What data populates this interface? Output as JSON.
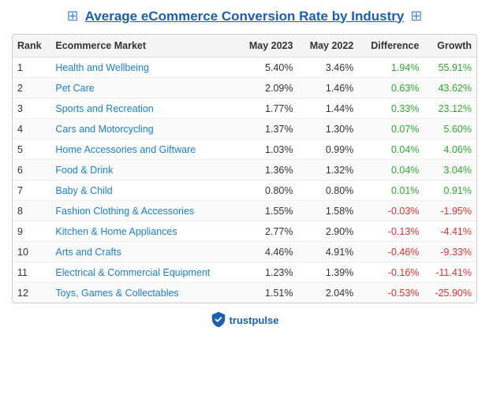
{
  "title": "Average eCommerce Conversion Rate by Industry",
  "table": {
    "headers": [
      "Rank",
      "Ecommerce Market",
      "May 2023",
      "May 2022",
      "Difference",
      "Growth"
    ],
    "rows": [
      {
        "rank": "1",
        "market": "Health and Wellbeing",
        "may2023": "5.40%",
        "may2022": "3.46%",
        "difference": "1.94%",
        "growth": "55.91%",
        "diff_positive": true,
        "growth_positive": true
      },
      {
        "rank": "2",
        "market": "Pet Care",
        "may2023": "2.09%",
        "may2022": "1.46%",
        "difference": "0.63%",
        "growth": "43.62%",
        "diff_positive": true,
        "growth_positive": true
      },
      {
        "rank": "3",
        "market": "Sports and Recreation",
        "may2023": "1.77%",
        "may2022": "1.44%",
        "difference": "0.33%",
        "growth": "23.12%",
        "diff_positive": true,
        "growth_positive": true
      },
      {
        "rank": "4",
        "market": "Cars and Motorcycling",
        "may2023": "1.37%",
        "may2022": "1.30%",
        "difference": "0.07%",
        "growth": "5.60%",
        "diff_positive": true,
        "growth_positive": true
      },
      {
        "rank": "5",
        "market": "Home Accessories and Giftware",
        "may2023": "1.03%",
        "may2022": "0.99%",
        "difference": "0.04%",
        "growth": "4.06%",
        "diff_positive": true,
        "growth_positive": true
      },
      {
        "rank": "6",
        "market": "Food & Drink",
        "may2023": "1.36%",
        "may2022": "1.32%",
        "difference": "0.04%",
        "growth": "3.04%",
        "diff_positive": true,
        "growth_positive": true
      },
      {
        "rank": "7",
        "market": "Baby & Child",
        "may2023": "0.80%",
        "may2022": "0.80%",
        "difference": "0.01%",
        "growth": "0.91%",
        "diff_positive": true,
        "growth_positive": true
      },
      {
        "rank": "8",
        "market": "Fashion Clothing & Accessories",
        "may2023": "1.55%",
        "may2022": "1.58%",
        "difference": "-0.03%",
        "growth": "-1.95%",
        "diff_positive": false,
        "growth_positive": false
      },
      {
        "rank": "9",
        "market": "Kitchen & Home Appliances",
        "may2023": "2.77%",
        "may2022": "2.90%",
        "difference": "-0.13%",
        "growth": "-4.41%",
        "diff_positive": false,
        "growth_positive": false
      },
      {
        "rank": "10",
        "market": "Arts and Crafts",
        "may2023": "4.46%",
        "may2022": "4.91%",
        "difference": "-0.46%",
        "growth": "-9.33%",
        "diff_positive": false,
        "growth_positive": false
      },
      {
        "rank": "11",
        "market": "Electrical & Commercial Equipment",
        "may2023": "1.23%",
        "may2022": "1.39%",
        "difference": "-0.16%",
        "growth": "-11.41%",
        "diff_positive": false,
        "growth_positive": false
      },
      {
        "rank": "12",
        "market": "Toys, Games & Collectables",
        "may2023": "1.51%",
        "may2022": "2.04%",
        "difference": "-0.53%",
        "growth": "-25.90%",
        "diff_positive": false,
        "growth_positive": false
      }
    ]
  },
  "footer": {
    "brand": "trustpulse"
  }
}
